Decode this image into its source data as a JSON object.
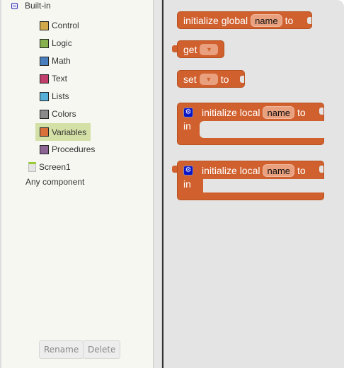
{
  "tree": {
    "root": "Built-in",
    "items": [
      {
        "label": "Control",
        "color": "#d1a84a"
      },
      {
        "label": "Logic",
        "color": "#87b04e"
      },
      {
        "label": "Math",
        "color": "#4a7fbf"
      },
      {
        "label": "Text",
        "color": "#c13f6a"
      },
      {
        "label": "Lists",
        "color": "#57b0d8"
      },
      {
        "label": "Colors",
        "color": "#8a8a8a"
      },
      {
        "label": "Variables",
        "color": "#d8703a"
      },
      {
        "label": "Procedures",
        "color": "#8c6595"
      }
    ],
    "screen": "Screen1",
    "any": "Any component"
  },
  "buttons": {
    "rename": "Rename",
    "delete": "Delete"
  },
  "blocks": {
    "global": {
      "a": "initialize global",
      "name": "name",
      "b": "to"
    },
    "get": {
      "a": "get",
      "arrow": "▼"
    },
    "set": {
      "a": "set",
      "arrow": "▼",
      "b": "to"
    },
    "local1": {
      "gear": "⚙",
      "a": "initialize local",
      "name": "name",
      "b": "to",
      "in": "in"
    },
    "local2": {
      "gear": "⚙",
      "a": "initialize local",
      "name": "name",
      "b": "to",
      "in": "in"
    }
  }
}
